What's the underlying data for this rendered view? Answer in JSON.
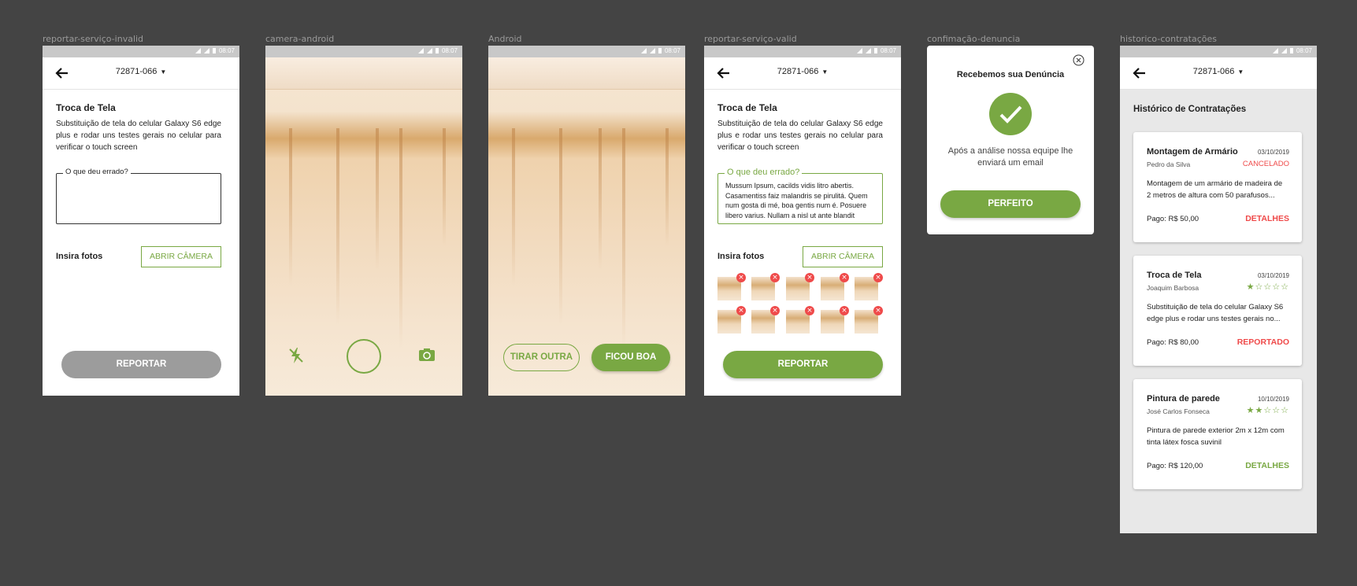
{
  "colors": {
    "background": "#444444",
    "accent": "#79a843",
    "danger": "#ef4a4a",
    "disabled": "#9c9c9c"
  },
  "status_time": "08:07",
  "cep": "72871-066",
  "labels": {
    "f1": "reportar-serviço-invalid",
    "f2": "camera-android",
    "f3": "Android",
    "f4": "reportar-serviço-valid",
    "f5": "confimação-denuncia",
    "f6": "historico-contratações"
  },
  "report": {
    "title": "Troca de Tela",
    "description": "Substituição de tela do celular Galaxy S6 edge plus e rodar uns testes gerais no celular para verificar o touch screen",
    "field_label": "O que deu errado?",
    "field_value": "Mussum Ipsum, cacilds vidis litro abertis. Casamentiss faiz malandris se pirulitá. Quem num gosta di mé, boa gentis num é. Posuere libero varius. Nullam a nisl ut ante blandit",
    "photos_label": "Insira fotos",
    "camera_button": "ABRIR CÂMERA",
    "submit_button": "REPORTAR"
  },
  "camera": {
    "flash_icon": "flash-off-icon",
    "shutter_icon": "shutter-icon",
    "switch_icon": "camera-switch-icon"
  },
  "preview": {
    "retake_button": "TIRAR OUTRA",
    "accept_button": "FICOU BOA"
  },
  "confirm": {
    "title": "Recebemos sua Denúncia",
    "message": "Após a análise nossa equipe lhe enviará um email",
    "button": "PERFEITO",
    "close_icon": "close-icon",
    "check_icon": "check-icon"
  },
  "history": {
    "title": "Histórico de Contratações",
    "cards": [
      {
        "title": "Montagem de Armário",
        "date": "03/10/2019",
        "name": "Pedro da Silva",
        "status": "CANCELADO",
        "stars": 0,
        "desc": "Montagem de um armário de madeira de 2 metros de altura com 50 parafusos...",
        "paid": "Pago: R$ 50,00",
        "action": "DETALHES"
      },
      {
        "title": "Troca de Tela",
        "date": "03/10/2019",
        "name": "Joaquim Barbosa",
        "status": "",
        "stars": 1,
        "desc": "Substituição de tela do celular Galaxy S6 edge plus e rodar uns testes gerais no...",
        "paid": "Pago: R$ 80,00",
        "action": "REPORTADO"
      },
      {
        "title": "Pintura de parede",
        "date": "10/10/2019",
        "name": "José Carlos Fonseca",
        "status": "",
        "stars": 2,
        "desc": "Pintura de parede exterior 2m x 12m com tinta látex fosca suvinil",
        "paid": "Pago: R$ 120,00",
        "action": "DETALHES"
      }
    ]
  }
}
